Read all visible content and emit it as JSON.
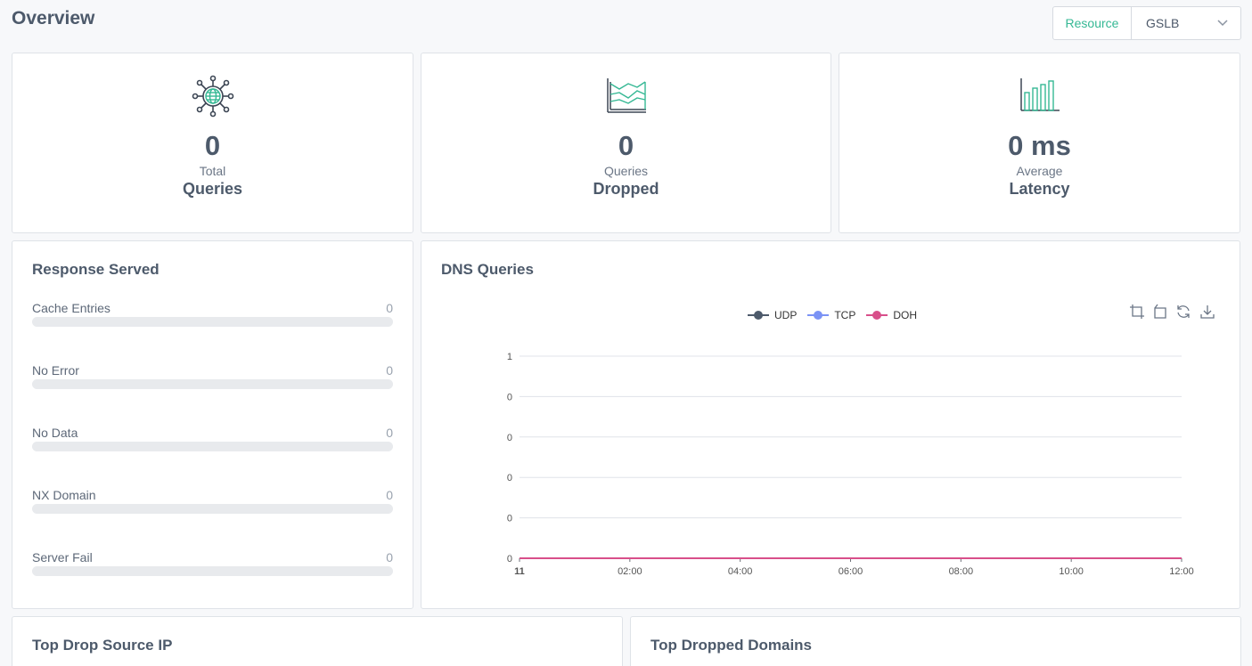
{
  "header": {
    "title": "Overview",
    "resource_label": "Resource",
    "resource_value": "GSLB"
  },
  "stats": [
    {
      "value": "0",
      "sub": "Total",
      "main": "Queries",
      "icon": "network-globe-icon"
    },
    {
      "value": "0",
      "sub": "Queries",
      "main": "Dropped",
      "icon": "area-chart-icon"
    },
    {
      "value": "0 ms",
      "sub": "Average",
      "main": "Latency",
      "icon": "bar-chart-icon"
    }
  ],
  "response": {
    "title": "Response Served",
    "items": [
      {
        "label": "Cache Entries",
        "value": "0"
      },
      {
        "label": "No Error",
        "value": "0"
      },
      {
        "label": "No Data",
        "value": "0"
      },
      {
        "label": "NX Domain",
        "value": "0"
      },
      {
        "label": "Server Fail",
        "value": "0"
      }
    ]
  },
  "dns": {
    "title": "DNS Queries",
    "toolbar": [
      "zoom-icon",
      "zoom-reset-icon",
      "refresh-icon",
      "download-icon"
    ]
  },
  "chart_data": {
    "type": "line",
    "x": [
      "11",
      "02:00",
      "04:00",
      "06:00",
      "08:00",
      "10:00",
      "12:00"
    ],
    "y_ticks": [
      "0",
      "0",
      "0",
      "0",
      "0",
      "1"
    ],
    "ylim": [
      0,
      1
    ],
    "grid": true,
    "legend": "top",
    "series": [
      {
        "name": "UDP",
        "color": "#4d5a6b",
        "values": [
          0,
          0,
          0,
          0,
          0,
          0,
          0
        ]
      },
      {
        "name": "TCP",
        "color": "#7b93f5",
        "values": [
          0,
          0,
          0,
          0,
          0,
          0,
          0
        ]
      },
      {
        "name": "DOH",
        "color": "#d84f8a",
        "values": [
          0,
          0,
          0,
          0,
          0,
          0,
          0
        ]
      }
    ]
  },
  "bottom": {
    "drop_source_title": "Top Drop Source IP",
    "dropped_domains_title": "Top Dropped Domains"
  },
  "colors": {
    "accent": "#35b894",
    "text": "#4d5a6b"
  }
}
